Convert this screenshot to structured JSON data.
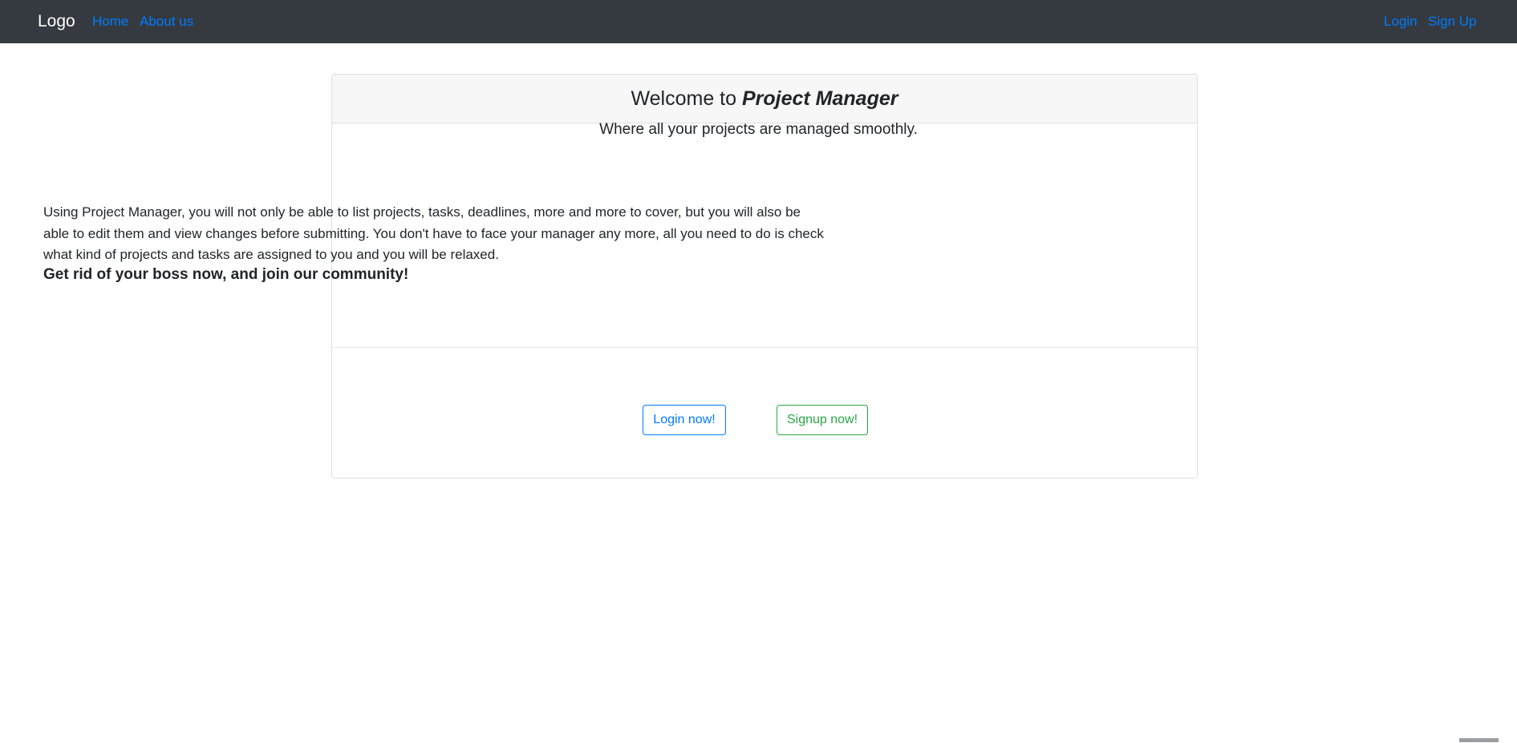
{
  "navbar": {
    "brand": "Logo",
    "links_left": [
      "Home",
      "About us"
    ],
    "links_right": [
      "Login",
      "Sign Up"
    ]
  },
  "card": {
    "header_prefix": "Welcome to ",
    "header_brand": "Project Manager",
    "tagline": "Where all your projects are managed smoothly.",
    "description": "Using Project Manager, you will not only be able to list projects, tasks, deadlines, more and more to cover, but you will also be able to edit them and view changes before submitting. You don't have to face your manager any more, all you need to do is check what kind of projects and tasks are assigned to you and you will be relaxed.",
    "call_to_action": "Get rid of your boss now, and join our community!",
    "login_button": "Login now!",
    "signup_button": "Signup now!"
  },
  "colors": {
    "navbar_bg": "#343a40",
    "link": "#007bff",
    "success": "#28a745",
    "header_bg": "#f7f7f7"
  },
  "icons": {
    "scroll_indicator": "scrollbar-thumb"
  }
}
